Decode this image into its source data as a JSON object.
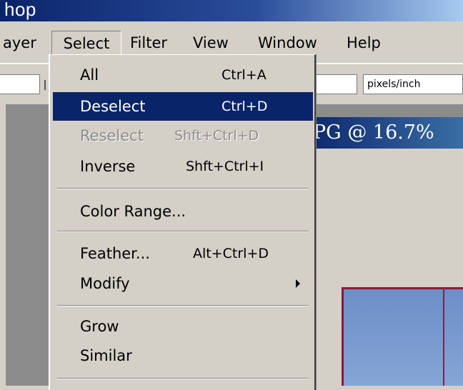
{
  "app": {
    "title": "hop"
  },
  "menubar": {
    "items": [
      {
        "label": "ayer"
      },
      {
        "label": "Select"
      },
      {
        "label": "Filter"
      },
      {
        "label": "View"
      },
      {
        "label": "Window"
      },
      {
        "label": "Help"
      }
    ],
    "active": "Select"
  },
  "options_bar": {
    "resolution_units": "pixels/inch"
  },
  "document": {
    "title": "PG @ 16.7%"
  },
  "select_menu": {
    "items": [
      {
        "label": "All",
        "shortcut": "Ctrl+A",
        "state": "normal"
      },
      {
        "label": "Deselect",
        "shortcut": "Ctrl+D",
        "state": "highlighted"
      },
      {
        "label": "Reselect",
        "shortcut": "Shft+Ctrl+D",
        "state": "disabled"
      },
      {
        "label": "Inverse",
        "shortcut": "Shft+Ctrl+I",
        "state": "normal"
      },
      {
        "label": "Color Range...",
        "shortcut": "",
        "state": "normal"
      },
      {
        "label": "Feather...",
        "shortcut": "Alt+Ctrl+D",
        "state": "normal"
      },
      {
        "label": "Modify",
        "shortcut": "",
        "state": "submenu"
      },
      {
        "label": "Grow",
        "shortcut": "",
        "state": "normal"
      },
      {
        "label": "Similar",
        "shortcut": "",
        "state": "normal"
      }
    ]
  },
  "colors": {
    "titlebar": "#0a246a",
    "menu_bg": "#d4d0c8",
    "highlight": "#0a246a",
    "disabled_text": "#8c8c8c",
    "workspace": "#8c8c8c"
  }
}
